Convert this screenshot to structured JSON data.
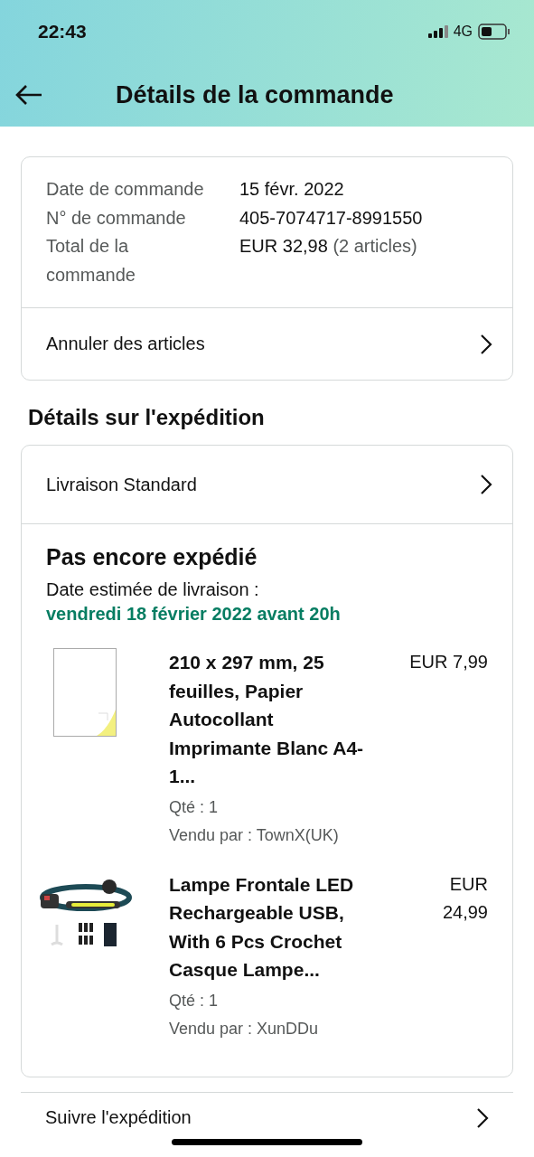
{
  "status_bar": {
    "time": "22:43",
    "network": "4G"
  },
  "header": {
    "title": "Détails de la commande"
  },
  "order_summary": {
    "rows": [
      {
        "label": "Date de commande",
        "value": "15 févr. 2022"
      },
      {
        "label": "N° de commande",
        "value": "405-7074717-8991550"
      },
      {
        "label": "Total de la commande",
        "value": "EUR 32,98",
        "note": "(2 articles)"
      }
    ],
    "action": "Annuler des articles"
  },
  "shipping": {
    "heading": "Détails sur l'expédition",
    "method": "Livraison Standard",
    "status": "Pas encore expédié",
    "estimate_label": "Date estimée de livraison :",
    "estimate_date": "vendredi 18 février 2022 avant 20h",
    "items": [
      {
        "kind": "picture",
        "title": "210 x 297 mm, 25 feuilles, Papier Autocollant Imprimante Blanc A4-1...",
        "price": "EUR 7,99",
        "qty": "Qté : 1",
        "seller": "Vendu par : TownX(UK)"
      },
      {
        "kind": "picture",
        "title": "Lampe Frontale LED Rechargeable USB, With 6 Pcs Crochet Casque Lampe...",
        "price": "EUR 24,99",
        "qty": "Qté : 1",
        "seller": "Vendu par : XunDDu"
      }
    ]
  },
  "track_link": "Suivre l'expédition"
}
